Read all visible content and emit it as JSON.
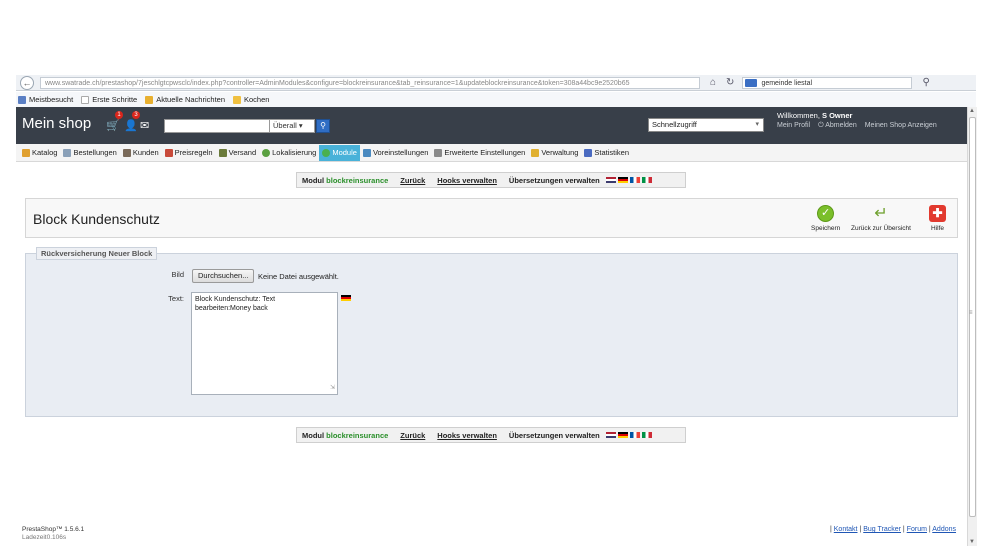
{
  "browser": {
    "url": "www.swatrade.ch/prestashop/7jeschlgtcpwsclc/index.php?controller=AdminModules&configure=blockreinsurance&tab_reinsurance=1&updateblockreinsurance&token=308a44bc9e2520b65",
    "search_value": "gemeinde liestal",
    "bookmarks": [
      "Meistbesucht",
      "Erste Schritte",
      "Aktuelle Nachrichten",
      "Kochen"
    ]
  },
  "header": {
    "shop_title": "Mein shop",
    "cart_badge": "1",
    "customers_badge": "3",
    "search_placeholder": "",
    "search_scope": "Überall",
    "quick_access": "Schnellzugriff",
    "welcome_prefix": "Willkommen,",
    "welcome_name": "S Owner",
    "links": {
      "profile": "Mein Profil",
      "logout": "Abmelden",
      "view_shop": "Meinen Shop Anzeigen"
    }
  },
  "tabs": [
    {
      "label": "Katalog",
      "color": "#e0a030"
    },
    {
      "label": "Bestellungen",
      "color": "#8aa0b8"
    },
    {
      "label": "Kunden",
      "color": "#7a6a5a"
    },
    {
      "label": "Preisregeln",
      "color": "#c84a3a"
    },
    {
      "label": "Versand",
      "color": "#6a7a3a"
    },
    {
      "label": "Lokalisierung",
      "color": "#5aa040"
    },
    {
      "label": "Module",
      "color": "#4ab050"
    },
    {
      "label": "Voreinstellungen",
      "color": "#4a8ac0"
    },
    {
      "label": "Erweiterte Einstellungen",
      "color": "#8a8a8a"
    },
    {
      "label": "Verwaltung",
      "color": "#e0b030"
    },
    {
      "label": "Statistiken",
      "color": "#4a6ac0"
    }
  ],
  "active_tab_color": "#49b2d9",
  "module_bar": {
    "modul_label": "Modul",
    "module_name": "blockreinsurance",
    "back": "Zurück",
    "hooks": "Hooks verwalten",
    "translations": "Übersetzungen verwalten"
  },
  "toolbar": {
    "title": "Block Kundenschutz",
    "save": "Speichern",
    "back_overview": "Zurück zur Übersicht",
    "help": "Hilfe"
  },
  "form": {
    "legend": "Rückversicherung Neuer Block",
    "image_label": "Bild",
    "file_button": "Durchsuchen...",
    "file_status": "Keine Datei ausgewählt.",
    "text_label": "Text:",
    "text_value": "Block Kundenschutz: Text\nbearbeiten:Money back"
  },
  "footer": {
    "version": "PrestaShop™ 1.5.6.1",
    "load_time": "Ladezeit0.106s",
    "links": [
      "Kontakt",
      "Bug Tracker",
      "Forum",
      "Addons"
    ]
  }
}
